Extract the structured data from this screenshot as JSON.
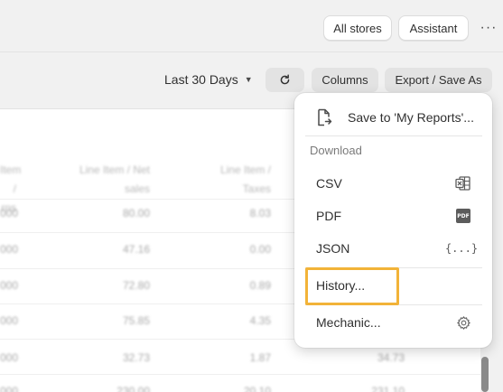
{
  "header": {
    "all_stores_label": "All stores",
    "assistant_label": "Assistant",
    "more_label": "···"
  },
  "toolbar": {
    "date_range": "Last 30 Days",
    "refresh_icon": "refresh-icon",
    "columns_label": "Columns",
    "export_label": "Export / Save As"
  },
  "table": {
    "headers": [
      {
        "line1": "Item /",
        "line2": "rns"
      },
      {
        "line1": "Line Item / Net",
        "line2": "sales"
      },
      {
        "line1": "Line Item /",
        "line2": "Taxes"
      }
    ],
    "rows": [
      [
        "000",
        "80.00",
        "8.03"
      ],
      [
        "000",
        "47.16",
        "0.00"
      ],
      [
        "000",
        "72.80",
        "0.89"
      ],
      [
        "000",
        "75.85",
        "4.35"
      ],
      [
        "000",
        "32.73",
        "1.87"
      ],
      [
        "000",
        "230.00",
        "20.10"
      ]
    ],
    "right_cells": [
      "34.73",
      "231.10"
    ]
  },
  "menu": {
    "save_label": "Save to 'My Reports'...",
    "download_section": "Download",
    "csv_label": "CSV",
    "pdf_label": "PDF",
    "pdf_icon_text": "PDF",
    "json_label": "JSON",
    "json_icon_text": "{...}",
    "history_label": "History...",
    "mechanic_label": "Mechanic..."
  },
  "colors": {
    "highlight": "#f2b338",
    "background": "#f1f1f1"
  }
}
